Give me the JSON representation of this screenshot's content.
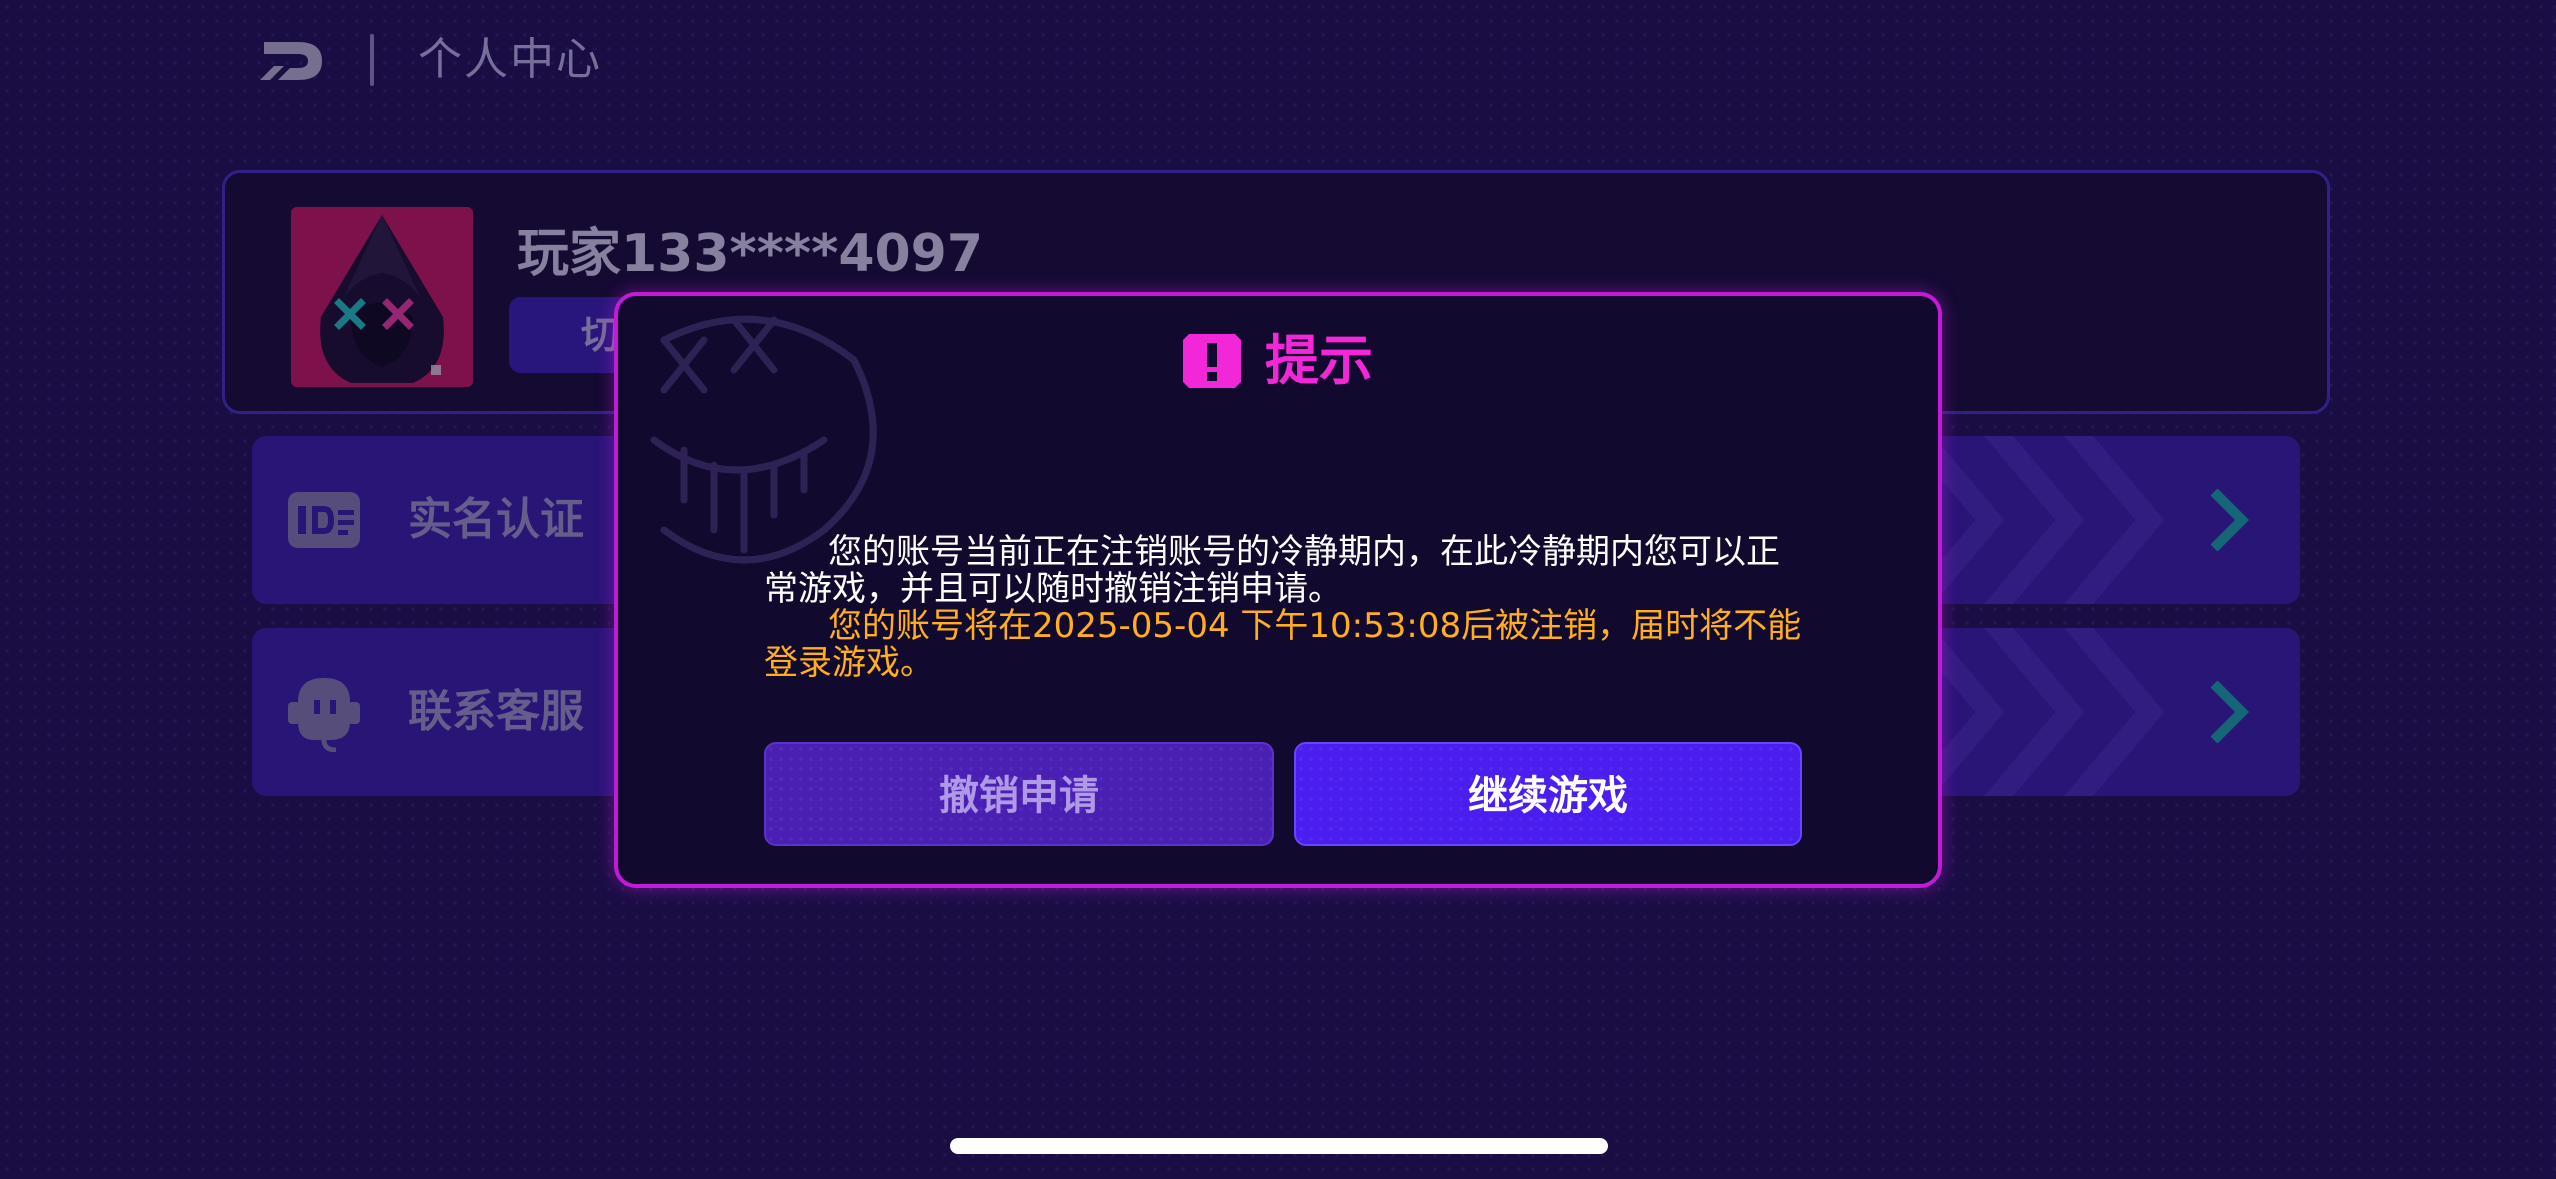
{
  "header": {
    "back_icon": "back-logo-icon",
    "title": "个人中心"
  },
  "profile": {
    "avatar_icon": "hooded-avatar-icon",
    "name": "玩家133****4097",
    "switch_label": "切"
  },
  "menu": [
    {
      "icon": "id-card-icon",
      "label": "实名认证",
      "arrow_icon": "chevron-right-icon"
    },
    {
      "icon": "customer-service-icon",
      "label": "联系客服",
      "arrow_icon": "chevron-right-icon"
    }
  ],
  "dialog": {
    "icon": "exclamation-icon",
    "title": "提示",
    "message": "您的账号当前正在注销账号的冷静期内，在此冷静期内您可以正常游戏，并且可以随时撤销注销申请。",
    "warning": "您的账号将在2025-05-04 下午10:53:08后被注销，届时将不能登录游戏。",
    "cancel_label": "撤销申请",
    "continue_label": "继续游戏"
  },
  "colors": {
    "background": "#1f1252",
    "dialog_border": "#c21ad6",
    "title_accent": "#f227d8",
    "warning_text": "#ffae1f",
    "primary_button": "#4b1ef0",
    "secondary_button": "#4a1fb4",
    "arrow": "#19b3b3"
  }
}
